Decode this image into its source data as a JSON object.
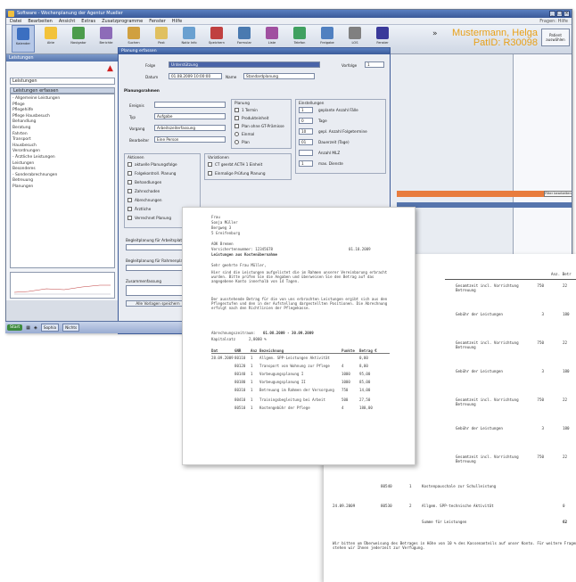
{
  "app": {
    "title": "Software - Wochenplanung der Agentur Mueller",
    "menu": [
      "Datei",
      "Bearbeiten",
      "Ansicht",
      "Extras",
      "Zusatzprogramme",
      "Fenster",
      "Hilfe"
    ],
    "menu_hint": "Fragen: Hilfe",
    "toolbar": [
      {
        "label": "Kalender",
        "color": "#3b6fc1"
      },
      {
        "label": "Akte",
        "color": "#f2c23a"
      },
      {
        "label": "Navigator",
        "color": "#4c9c4c"
      },
      {
        "label": "Berichte",
        "color": "#8d6bb8"
      },
      {
        "label": "Suchen",
        "color": "#d0a040"
      },
      {
        "label": "Post",
        "color": "#e0c060"
      },
      {
        "label": "Notiz Info",
        "color": "#6aa0d0"
      },
      {
        "label": "Speichern",
        "color": "#c04040"
      },
      {
        "label": "Formular",
        "color": "#4a7ab0"
      },
      {
        "label": "Liste",
        "color": "#a050a0"
      },
      {
        "label": "Telefon",
        "color": "#40a060"
      },
      {
        "label": "Freigabe",
        "color": "#5080c0"
      },
      {
        "label": "LOS",
        "color": "#808080"
      },
      {
        "label": "Fenster",
        "color": "#3a3a9a"
      }
    ],
    "user_name": "Mustermann, Helga",
    "user_id": "PatID: R30098",
    "context_button": "Patient auswählen",
    "left_header": "Leistungen",
    "left_select": "Leistungen",
    "left_treehead": "Leistungen erfassen",
    "tree": [
      "- Allgemeine Leistungen",
      "     Pflege",
      "     Pflegehilfe",
      "     Pflege Hausbesuch",
      "     Behandlung",
      "     Beratung",
      "     Fahrten",
      "     Transport",
      "     Hausbesuch",
      "     Verordnungen",
      "- Ärztliche Leistungen",
      "     Leistungen",
      "     Besonderes",
      "- Sonderabrechnungen",
      "     Betreuung",
      "     Planungen"
    ],
    "taskbar": {
      "start": "Start",
      "items": [
        "Sophia",
        "Nichts"
      ]
    },
    "orange_button": "Filter bearbeiten"
  },
  "dialog": {
    "title": "Planung erfassen",
    "fields": {
      "folge_label": "Folge",
      "folge_value": "Unterstützung",
      "vorfolge_label": "Vorfolge",
      "vorfolge_value": "1",
      "datum_label": "Datum",
      "datum_value": "01.08.2009 10:00:00",
      "name_label": "Name",
      "name_value": "Standardplanung"
    },
    "planungsrahmen": "Planungsrahmen",
    "left_rows": [
      {
        "label": "Ereignis",
        "value": ""
      },
      {
        "label": "Typ",
        "value": "Aufgabe"
      },
      {
        "label": "Vorgang",
        "value": "Arbeitszeiterfassung"
      },
      {
        "label": "Bearbeiter",
        "value": "Eine Person"
      }
    ],
    "planung_title": "Planung",
    "planung_options": [
      "1 Termin",
      "Produkteinheit",
      "Plan ohne GT-Prämisse",
      "Einmal",
      "Plan"
    ],
    "einstellungen_title": "Einstellungen",
    "einstellungen": [
      {
        "value": "1",
        "label": "geplante Anzahl Fälle"
      },
      {
        "value": "0",
        "label": "Tage"
      },
      {
        "value": "10",
        "label": "gepl. Anzahl Folgetermine"
      },
      {
        "value": "01",
        "label": "Dauerzeit (Tage)"
      },
      {
        "value": "",
        "label": "Anzahl MLZ"
      },
      {
        "value": "1",
        "label": "max. Dienste"
      }
    ],
    "aktionen_title": "Aktionen",
    "aktionen": [
      "aktuelle Planungsfolge",
      "Folgekontroll. Planung",
      "Behandlungen",
      "Zahnschaden",
      "Abrechnungen",
      "Ärztliche",
      "Verrechnet Planung"
    ],
    "variationen_title": "Variationen",
    "variationen": [
      "CT geerbt ACTH 1 Einheit",
      "Einmalige Prüfung Planung"
    ],
    "bottom_labels": [
      "Begleitplanung für Arbeitsplatz",
      "Begleitplanung für Rahmenplanung"
    ],
    "summary_label": "Zusammenfassung",
    "bottom_button": "Alle Vorlagen speichern"
  },
  "letter": {
    "addr": [
      "Frau",
      "Sonja Müller",
      "Bergweg 3",
      "5 Greifenburg"
    ],
    "insurer": "AOK Bremen",
    "ref": "Versichertennummer: 12345678",
    "date": "01.10.2009",
    "subject": "Leistungen aus Kostenübernahme",
    "salutation": "Sehr geehrte Frau Müller,",
    "para1": "Hier sind die Leistungen aufgelistet die im Rahmen unserer Vereinbarung erbracht wurden. Bitte prüfen Sie die Angaben und überweisen Sie den Betrag auf das angegebene Konto innerhalb von 14 Tagen.",
    "para2": "Der ausstehende Betrag für die von uns erbrachten Leistungen ergibt sich aus den Pflegestufen und den in der Aufstellung dargestellten Positionen. Die Abrechnung erfolgt nach den Richtlinien der Pflegekasse.",
    "period_label": "Abrechnungszeitraum:",
    "period_value": "01.08.2009 - 30.09.2009",
    "rate_label": "Kapitalsatz",
    "rate_value": "2,0000 %",
    "table": {
      "headers": [
        "Dat",
        "GNR",
        "Anz",
        "Bezeichnung",
        "Punkte",
        "Betrag €"
      ],
      "rows": [
        [
          "28.09.2009",
          "80110",
          "1",
          "Allgem. SPP-Leistungen Aktivität",
          "",
          "0,00"
        ],
        [
          "",
          "80120",
          "1",
          "Transport von Wohnung zur Pflege",
          "4",
          "8,00"
        ],
        [
          "",
          "80140",
          "1",
          "Vorbeugungsplanung I",
          "1000",
          "95,00"
        ],
        [
          "",
          "80180",
          "1",
          "Vorbeugungsplanung II",
          "1000",
          "85,00"
        ],
        [
          "",
          "80310",
          "1",
          "Betreuung im Rahmen der Versorgung",
          "750",
          "14,00"
        ],
        [
          "",
          "80410",
          "1",
          "Trainingsbegleitung bei Arbeit",
          "500",
          "27,50"
        ],
        [
          "",
          "80510",
          "1",
          "Kostengebühr der Pflege",
          "4",
          "180,00"
        ]
      ]
    }
  },
  "list": {
    "header": "Anz. Betr",
    "rows": [
      {
        "text": "Gesamtzeit incl. Vorrichtung Betreuung",
        "qty": "750",
        "amt": "22"
      },
      {
        "text": "Gebühr der Leistungen",
        "qty": "3",
        "amt": "180"
      },
      {
        "text": "Gesamtzeit incl. Vorrichtung Betreuung",
        "qty": "750",
        "amt": "22"
      },
      {
        "text": "Gebühr der Leistungen",
        "qty": "3",
        "amt": "180"
      },
      {
        "text": "Gesamtzeit incl. Vorrichtung Betreuung",
        "qty": "750",
        "amt": "22"
      },
      {
        "text": "Gebühr der Leistungen",
        "qty": "3",
        "amt": "180"
      },
      {
        "text": "Gesamtzeit incl. Vorrichtung Betreuung",
        "qty": "750",
        "amt": "22"
      }
    ],
    "bottom_rows": [
      {
        "date": "",
        "code": "80540",
        "qty": "1",
        "text": "Kostenpauschale zur Schulleistung",
        "amt": ""
      },
      {
        "date": "24.09.2009",
        "code": "80530",
        "qty": "2",
        "text": "Allgem. SPP-technische Aktivität",
        "amt": "0"
      },
      {
        "date": "",
        "code": "",
        "qty": "",
        "text": "Summe für Leistungen",
        "amt": "62"
      }
    ],
    "footer": "Wir bitten um Überweisung des Betrages in Höhe von 10 % des Kassenanteils auf unser Konto. Für weitere Fragen stehen wir Ihnen jederzeit zur Verfügung."
  }
}
